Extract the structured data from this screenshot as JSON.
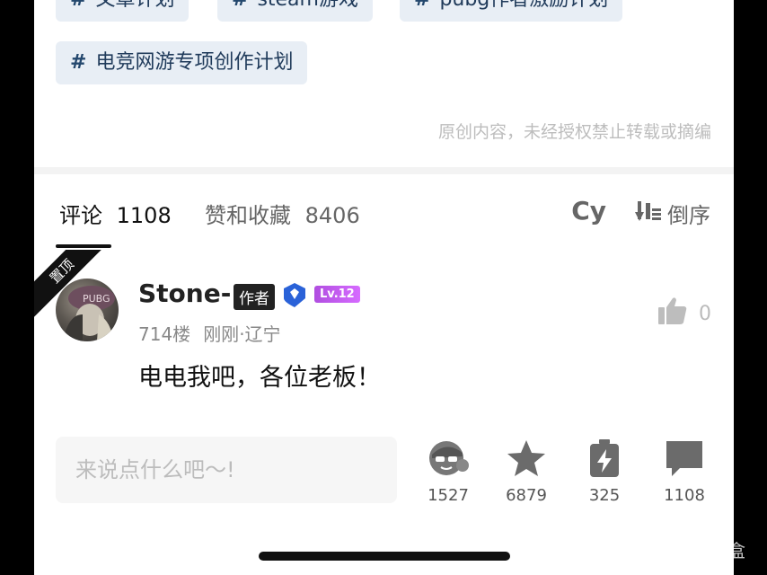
{
  "tags": [
    {
      "hash": "#",
      "label": "文章计划"
    },
    {
      "hash": "#",
      "label": "steam游戏"
    },
    {
      "hash": "#",
      "label": "pubg作者激励计划"
    },
    {
      "hash": "#",
      "label": "电竞网游专项创作计划"
    }
  ],
  "copyright": "原创内容，未经授权禁止转载或摘编",
  "tabs": {
    "comments_label": "评论",
    "comments_count": "1108",
    "likes_label": "赞和收藏",
    "likes_count": "8406"
  },
  "cy_label": "Cy",
  "sort_label": "倒序",
  "pinned_label": "置顶",
  "comment": {
    "username": "Stone-",
    "author_badge": "作者",
    "level": "Lv.12",
    "floor": "714楼",
    "time": "刚刚",
    "location": "辽宁",
    "location_sep": "·",
    "text": "电电我吧，各位老板！",
    "likes": "0"
  },
  "input_placeholder": "来说点什么吧～!",
  "actions": [
    {
      "icon": "charge-face-icon",
      "count": "1527"
    },
    {
      "icon": "star-icon",
      "count": "6879"
    },
    {
      "icon": "battery-icon",
      "count": "325"
    },
    {
      "icon": "comment-icon",
      "count": "1108"
    }
  ],
  "watermark": "小黑盒",
  "colors": {
    "tag_bg": "#e8eef5",
    "tag_text": "#1f3a5a",
    "level_badge": "#c15cf0",
    "shield": "#2a62d8"
  }
}
